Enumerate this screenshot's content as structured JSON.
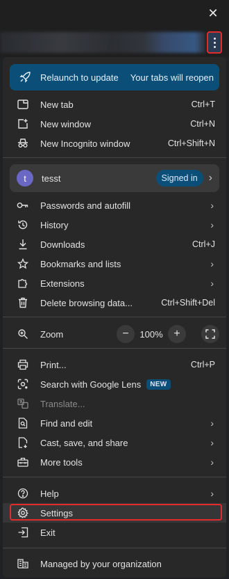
{
  "menu": {
    "relaunch": {
      "label": "Relaunch to update",
      "sublabel": "Your tabs will reopen"
    },
    "group1": [
      {
        "label": "New tab",
        "shortcut": "Ctrl+T",
        "icon": "new-tab-icon"
      },
      {
        "label": "New window",
        "shortcut": "Ctrl+N",
        "icon": "new-window-icon"
      },
      {
        "label": "New Incognito window",
        "shortcut": "Ctrl+Shift+N",
        "icon": "incognito-icon"
      }
    ],
    "profile": {
      "avatar_letter": "t",
      "name": "tesst",
      "status": "Signed in"
    },
    "group2": [
      {
        "label": "Passwords and autofill",
        "icon": "key-icon"
      },
      {
        "label": "History",
        "icon": "history-icon"
      },
      {
        "label": "Downloads",
        "shortcut": "Ctrl+J",
        "icon": "download-icon"
      },
      {
        "label": "Bookmarks and lists",
        "icon": "star-icon"
      },
      {
        "label": "Extensions",
        "icon": "extension-icon"
      },
      {
        "label": "Delete browsing data...",
        "shortcut": "Ctrl+Shift+Del",
        "icon": "trash-icon"
      }
    ],
    "zoom": {
      "label": "Zoom",
      "value": "100%",
      "minus": "−",
      "plus": "+"
    },
    "group3": [
      {
        "label": "Print...",
        "shortcut": "Ctrl+P",
        "icon": "print-icon"
      },
      {
        "label": "Search with Google Lens",
        "badge": "NEW",
        "icon": "lens-icon"
      },
      {
        "label": "Translate...",
        "icon": "translate-icon",
        "disabled": true
      },
      {
        "label": "Find and edit",
        "icon": "find-icon"
      },
      {
        "label": "Cast, save, and share",
        "icon": "cast-icon"
      },
      {
        "label": "More tools",
        "icon": "toolbox-icon"
      }
    ],
    "group4": [
      {
        "label": "Help",
        "icon": "help-icon"
      },
      {
        "label": "Settings",
        "icon": "gear-icon"
      },
      {
        "label": "Exit",
        "icon": "exit-icon"
      }
    ],
    "managed": {
      "label": "Managed by your organization",
      "icon": "building-icon"
    }
  },
  "window": {
    "close_glyph": "✕"
  },
  "colors": {
    "menu_bg": "#282828",
    "accent": "#0b4f78",
    "highlight": "#e32b2b"
  }
}
